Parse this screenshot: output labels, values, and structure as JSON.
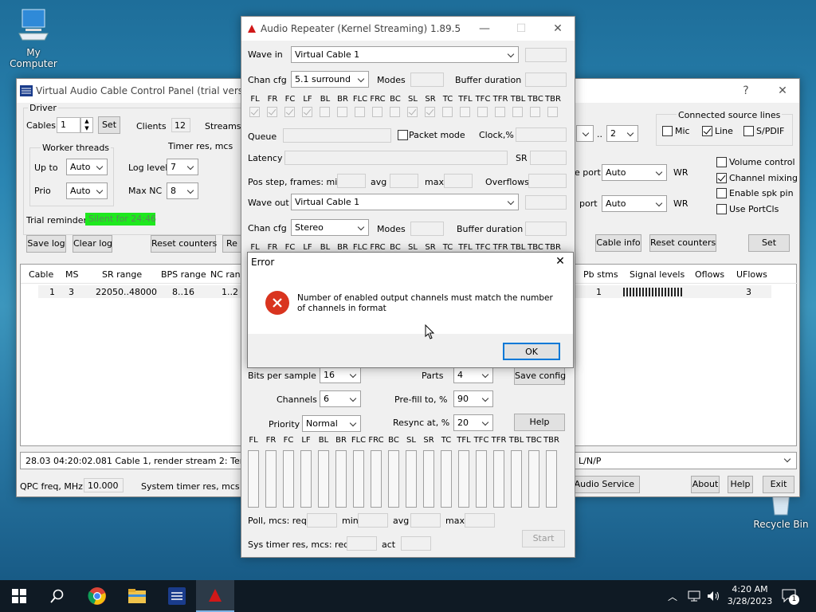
{
  "desktop": {
    "my_computer": "My Computer",
    "recycle_bin": "Recycle Bin"
  },
  "vac": {
    "title": "Virtual Audio Cable Control Panel (trial version)",
    "driver": "Driver",
    "cables": "Cables",
    "cables_val": "1",
    "set": "Set",
    "clients": "Clients",
    "clients_val": "12",
    "streams": "Streams",
    "worker_threads": "Worker threads",
    "up_to": "Up to",
    "up_to_val": "Auto",
    "prio": "Prio",
    "prio_val": "Auto",
    "timer_res": "Timer res, mcs",
    "log_level": "Log level",
    "log_level_val": "7",
    "max_nc": "Max NC",
    "max_nc_val": "8",
    "trial_reminder": "Trial reminder",
    "silent_for": "Silent for 24:46",
    "save_log": "Save log",
    "clear_log": "Clear log",
    "reset_counters": "Reset counters",
    "re": "Re",
    "connected_source_lines": "Connected source lines",
    "mic": "Mic",
    "line": "Line",
    "spdif": "S/PDIF",
    "dots": "..",
    "two": "2",
    "port1": "e port",
    "port2": "port",
    "auto": "Auto",
    "wr": "WR",
    "volume_control": "Volume control",
    "channel_mixing": "Channel mixing",
    "enable_spk_pin": "Enable spk pin",
    "use_portcls": "Use PortCls",
    "cable_info": "Cable info",
    "reset_counters2": "Reset counters",
    "set2": "Set",
    "table": {
      "headers_left": [
        "Cable",
        "MS",
        "SR range",
        "BPS range",
        "NC rang"
      ],
      "row_left": [
        "1",
        "3",
        "22050..48000",
        "8..16",
        "1..2"
      ],
      "headers_right": [
        "Pb stms",
        "Signal levels",
        "Oflows",
        "UFlows"
      ],
      "row_right": [
        "1",
        "",
        "3"
      ]
    },
    "status": "28.03  04:20:02.081  Cable 1, render stream 2: Termina",
    "status_right": "L/N/P",
    "qpc_freq": "QPC freq, MHz",
    "qpc_val": "10.000",
    "sys_timer_res": "System timer res, mcs",
    "audio_service": "t Audio Service",
    "about": "About",
    "help": "Help",
    "exit": "Exit"
  },
  "ar": {
    "title": "Audio Repeater (Kernel Streaming) 1.89.5",
    "wave_in": "Wave in",
    "wave_in_val": "Virtual Cable 1",
    "chan_cfg": "Chan cfg",
    "chan_cfg_in_val": "5.1 surround",
    "modes": "Modes",
    "buffer_duration": "Buffer duration",
    "channels": [
      "FL",
      "FR",
      "FC",
      "LF",
      "BL",
      "BR",
      "FLC",
      "FRC",
      "BC",
      "SL",
      "SR",
      "TC",
      "TFL",
      "TFC",
      "TFR",
      "TBL",
      "TBC",
      "TBR"
    ],
    "queue": "Queue",
    "packet_mode": "Packet mode",
    "clock": "Clock,%",
    "latency": "Latency",
    "sr": "SR",
    "pos_step": "Pos step, frames:  min",
    "avg": "avg",
    "max": "max",
    "overflows": "Overflows",
    "wave_out": "Wave out",
    "wave_out_val": "Virtual Cable 1",
    "chan_cfg_out_val": "Stereo",
    "bits_per_sample": "Bits per sample",
    "bits_val": "16",
    "parts": "Parts",
    "parts_val": "4",
    "save_config": "Save config",
    "channels_lbl": "Channels",
    "channels_val": "6",
    "prefill": "Pre-fill to, %",
    "prefill_val": "90",
    "priority": "Priority",
    "priority_val": "Normal",
    "resync": "Resync at, %",
    "resync_val": "20",
    "help": "Help",
    "poll": "Poll, mcs:  req",
    "min": "min",
    "sys_timer": "Sys timer res, mcs:  req",
    "act": "act",
    "start": "Start"
  },
  "err": {
    "title": "Error",
    "message": "Number of enabled output channels must match the number of channels in format",
    "ok": "OK"
  },
  "taskbar": {
    "time": "4:20 AM",
    "date": "3/28/2023",
    "notif_count": "1"
  },
  "colors": {
    "silent_bg": "#1ee81e",
    "error_red": "#d9341f",
    "ok_border": "#0078d7"
  }
}
